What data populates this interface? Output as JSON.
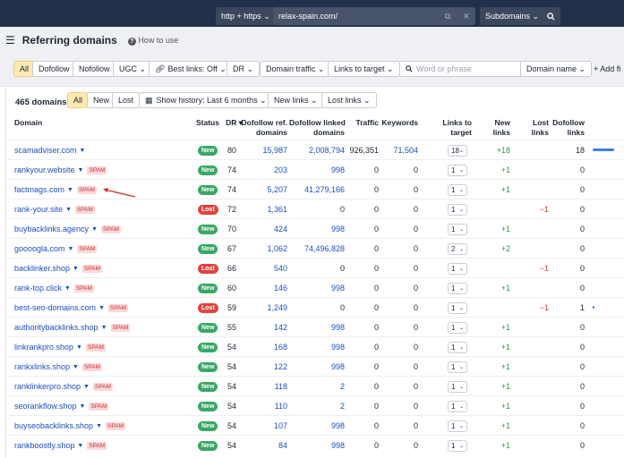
{
  "topbar": {
    "protocol": "http + https ⌄",
    "url": "relax-spain.com/",
    "scope": "Subdomains ⌄",
    "search_icon": "search-icon"
  },
  "header": {
    "title": "Referring domains",
    "howto": "How to use"
  },
  "filters": {
    "all": "All",
    "dofollow": "Dofollow",
    "nofollow": "Nofollow",
    "ugc": "UGC ⌄",
    "best_links": "Best links: Off ⌄",
    "dr": "DR ⌄",
    "domain_traffic": "Domain traffic ⌄",
    "links_to_target": "Links to target ⌄",
    "search_placeholder": "Word or phrase",
    "domain_name": "Domain name ⌄",
    "add_filter": "+ Add fi"
  },
  "subbar": {
    "count": "465 domains",
    "all": "All",
    "new": "New",
    "lost": "Lost",
    "history": "Show history: Last 6 months ⌄",
    "new_links": "New links ⌄",
    "lost_links": "Lost links ⌄"
  },
  "columns": {
    "domain": "Domain",
    "status": "Status",
    "dr": "DR ▾",
    "dofollow_ref": "Dofollow ref.\ndomains",
    "dofollow_linked": "Dofollow linked\ndomains",
    "traffic": "Traffic",
    "keywords": "Keywords",
    "links_to_target": "Links to target",
    "new_links": "New links",
    "lost_links": "Lost links",
    "dofollow_links": "Dofollow\nlinks"
  },
  "rows": [
    {
      "domain": "scamadviser.com",
      "spam": "",
      "status": "New",
      "dr": "80",
      "ref": "15,987",
      "linked": "2,008,794",
      "traffic": "926,351",
      "keywords": "71,504",
      "ltt": "18",
      "new": "+18",
      "lost": "",
      "dofollow": "18",
      "bar": 1
    },
    {
      "domain": "rankyour.website",
      "spam": "SPAM",
      "status": "New",
      "dr": "74",
      "ref": "203",
      "linked": "998",
      "traffic": "0",
      "keywords": "0",
      "ltt": "1",
      "new": "+1",
      "lost": "",
      "dofollow": "0",
      "bar": 0
    },
    {
      "domain": "factmags.com",
      "spam": "SPAM",
      "status": "New",
      "dr": "74",
      "ref": "5,207",
      "linked": "41,279,166",
      "traffic": "0",
      "keywords": "0",
      "ltt": "1",
      "new": "+1",
      "lost": "",
      "dofollow": "0",
      "bar": 0
    },
    {
      "domain": "rank-your.site",
      "spam": "SPAM",
      "status": "Lost",
      "dr": "72",
      "ref": "1,361",
      "linked": "0",
      "traffic": "0",
      "keywords": "0",
      "ltt": "1",
      "new": "",
      "lost": "−1",
      "dofollow": "0",
      "bar": 0
    },
    {
      "domain": "buybacklinks.agency",
      "spam": "SPAM",
      "status": "New",
      "dr": "70",
      "ref": "424",
      "linked": "998",
      "traffic": "0",
      "keywords": "0",
      "ltt": "1",
      "new": "+1",
      "lost": "",
      "dofollow": "0",
      "bar": 0
    },
    {
      "domain": "goooogla.com",
      "spam": "SPAM",
      "status": "New",
      "dr": "67",
      "ref": "1,062",
      "linked": "74,496,828",
      "traffic": "0",
      "keywords": "0",
      "ltt": "2",
      "new": "+2",
      "lost": "",
      "dofollow": "0",
      "bar": 0
    },
    {
      "domain": "backlinker.shop",
      "spam": "SPAM",
      "status": "Lost",
      "dr": "66",
      "ref": "540",
      "linked": "0",
      "traffic": "0",
      "keywords": "0",
      "ltt": "1",
      "new": "",
      "lost": "−1",
      "dofollow": "0",
      "bar": 0
    },
    {
      "domain": "rank-top.click",
      "spam": "SPAM",
      "status": "New",
      "dr": "60",
      "ref": "146",
      "linked": "998",
      "traffic": "0",
      "keywords": "0",
      "ltt": "1",
      "new": "+1",
      "lost": "",
      "dofollow": "0",
      "bar": 0
    },
    {
      "domain": "best-seo-domains.com",
      "spam": "SPAM",
      "status": "Lost",
      "dr": "59",
      "ref": "1,249",
      "linked": "0",
      "traffic": "0",
      "keywords": "0",
      "ltt": "1",
      "new": "",
      "lost": "−1",
      "dofollow": "1",
      "bar": 0.05
    },
    {
      "domain": "authoritybacklinks.shop",
      "spam": "SPAM",
      "status": "New",
      "dr": "55",
      "ref": "142",
      "linked": "998",
      "traffic": "0",
      "keywords": "0",
      "ltt": "1",
      "new": "+1",
      "lost": "",
      "dofollow": "0",
      "bar": 0
    },
    {
      "domain": "linkrankpro.shop",
      "spam": "SPAM",
      "status": "New",
      "dr": "54",
      "ref": "168",
      "linked": "998",
      "traffic": "0",
      "keywords": "0",
      "ltt": "1",
      "new": "+1",
      "lost": "",
      "dofollow": "0",
      "bar": 0
    },
    {
      "domain": "rankxlinks.shop",
      "spam": "SPAM",
      "status": "New",
      "dr": "54",
      "ref": "122",
      "linked": "998",
      "traffic": "0",
      "keywords": "0",
      "ltt": "1",
      "new": "+1",
      "lost": "",
      "dofollow": "0",
      "bar": 0
    },
    {
      "domain": "ranklinkerpro.shop",
      "spam": "SPAM",
      "status": "New",
      "dr": "54",
      "ref": "118",
      "linked": "2",
      "traffic": "0",
      "keywords": "0",
      "ltt": "1",
      "new": "+1",
      "lost": "",
      "dofollow": "0",
      "bar": 0
    },
    {
      "domain": "seorankflow.shop",
      "spam": "SPAM",
      "status": "New",
      "dr": "54",
      "ref": "110",
      "linked": "2",
      "traffic": "0",
      "keywords": "0",
      "ltt": "1",
      "new": "+1",
      "lost": "",
      "dofollow": "0",
      "bar": 0
    },
    {
      "domain": "buyseobacklinks.shop",
      "spam": "SPAM",
      "status": "New",
      "dr": "54",
      "ref": "107",
      "linked": "998",
      "traffic": "0",
      "keywords": "0",
      "ltt": "1",
      "new": "+1",
      "lost": "",
      "dofollow": "0",
      "bar": 0
    },
    {
      "domain": "rankboostly.shop",
      "spam": "SPAM",
      "status": "New",
      "dr": "54",
      "ref": "84",
      "linked": "998",
      "traffic": "0",
      "keywords": "0",
      "ltt": "1",
      "new": "+1",
      "lost": "",
      "dofollow": "0",
      "bar": 0
    }
  ],
  "colors": {
    "accent": "#3d7ee6",
    "new": "#3aa764",
    "lost": "#e0443c"
  }
}
